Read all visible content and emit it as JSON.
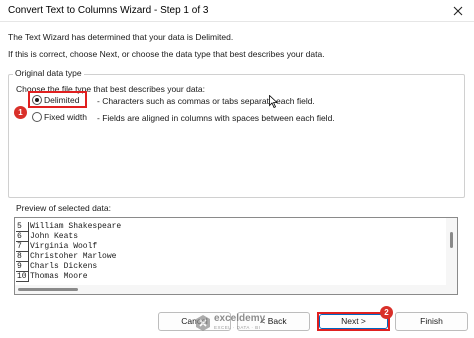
{
  "window": {
    "title": "Convert Text to Columns Wizard - Step 1 of 3"
  },
  "intro": {
    "line1": "The Text Wizard has determined that your data is Delimited.",
    "line2": "If this is correct, choose Next, or choose the data type that best describes your data."
  },
  "original_type": {
    "legend": "Original data type",
    "prompt": "Choose the file type that best describes your data:",
    "options": [
      {
        "label": "Delimited",
        "description": "- Characters such as commas or tabs separate each field.",
        "selected": true
      },
      {
        "label": "Fixed width",
        "description": "- Fields are aligned in columns with spaces between each field.",
        "selected": false
      }
    ]
  },
  "preview": {
    "label": "Preview of selected data:",
    "rows": [
      {
        "num": "5",
        "text": "William Shakespeare"
      },
      {
        "num": "6",
        "text": "John Keats"
      },
      {
        "num": "7",
        "text": "Virginia Woolf"
      },
      {
        "num": "8",
        "text": "Christoher Marlowe"
      },
      {
        "num": "9",
        "text": "Charls Dickens"
      },
      {
        "num": "10",
        "text": "Thomas Moore"
      }
    ]
  },
  "buttons": {
    "cancel": "Cancel",
    "back": "< Back",
    "next": "Next >",
    "finish": "Finish"
  },
  "markers": {
    "m1": "1",
    "m2": "2"
  },
  "watermark": {
    "brand": "exceldemy",
    "tagline": "EXCEL · DATA · BI"
  },
  "colors": {
    "highlight": "#e02020",
    "marker": "#d9302a",
    "default_button_border": "#0067c0"
  }
}
